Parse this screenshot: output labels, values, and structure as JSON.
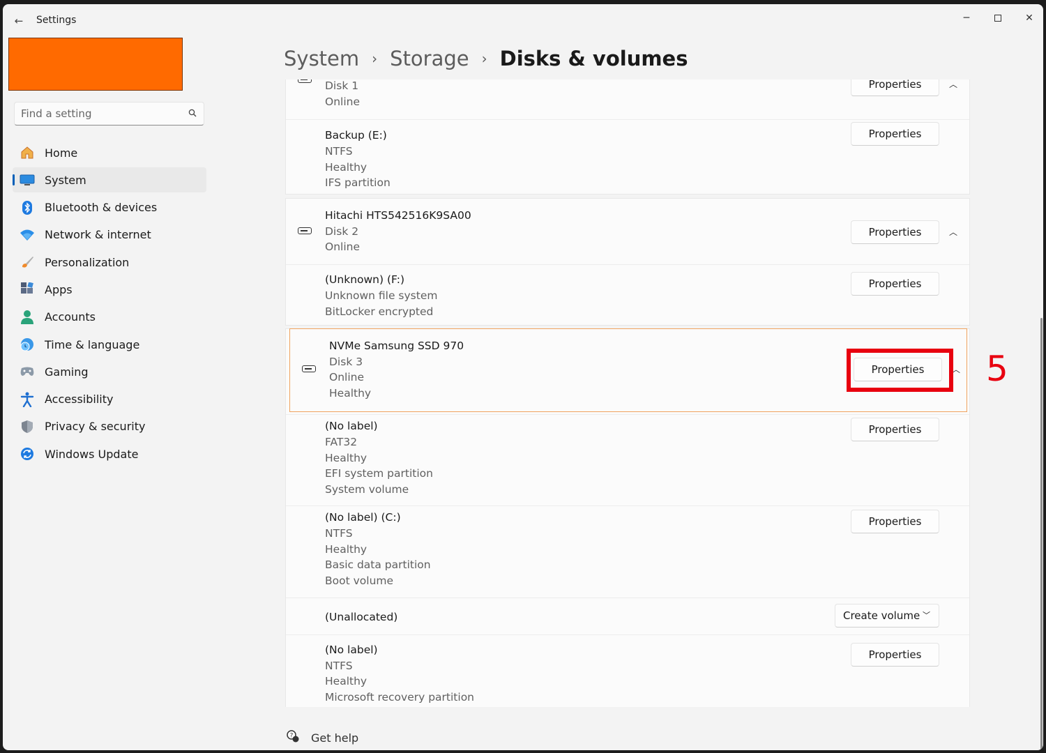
{
  "window": {
    "title": "Settings",
    "controls": {
      "minimize": "─",
      "maximize": "",
      "close": "✕"
    }
  },
  "search": {
    "placeholder": "Find a setting"
  },
  "sidebar": {
    "items": [
      {
        "label": "Home",
        "icon": "home-icon"
      },
      {
        "label": "System",
        "icon": "system-icon",
        "selected": true
      },
      {
        "label": "Bluetooth & devices",
        "icon": "bluetooth-icon"
      },
      {
        "label": "Network & internet",
        "icon": "wifi-icon"
      },
      {
        "label": "Personalization",
        "icon": "brush-icon"
      },
      {
        "label": "Apps",
        "icon": "apps-icon"
      },
      {
        "label": "Accounts",
        "icon": "accounts-icon"
      },
      {
        "label": "Time & language",
        "icon": "globe-clock-icon"
      },
      {
        "label": "Gaming",
        "icon": "gamepad-icon"
      },
      {
        "label": "Accessibility",
        "icon": "accessibility-icon"
      },
      {
        "label": "Privacy & security",
        "icon": "shield-icon"
      },
      {
        "label": "Windows Update",
        "icon": "update-icon"
      }
    ]
  },
  "breadcrumb": {
    "items": [
      "System",
      "Storage"
    ],
    "current": "Disks & volumes",
    "separator": "›"
  },
  "disks": {
    "disk1": {
      "lines": [
        "Disk 1",
        "Online"
      ],
      "button": "Properties",
      "volumes": [
        {
          "lines": [
            "Backup (E:)",
            "NTFS",
            "Healthy",
            "IFS partition"
          ],
          "button": "Properties"
        }
      ]
    },
    "disk2": {
      "lines": [
        "Hitachi HTS542516K9SA00",
        "Disk 2",
        "Online"
      ],
      "button": "Properties",
      "volumes": [
        {
          "lines": [
            "(Unknown) (F:)",
            "Unknown file system",
            "BitLocker encrypted"
          ],
          "button": "Properties"
        }
      ]
    },
    "disk3": {
      "lines": [
        "NVMe Samsung SSD 970",
        "Disk 3",
        "Online",
        "Healthy"
      ],
      "button": "Properties",
      "volumes": [
        {
          "lines": [
            "(No label)",
            "FAT32",
            "Healthy",
            "EFI system partition",
            "System volume"
          ],
          "button": "Properties"
        },
        {
          "lines": [
            "(No label) (C:)",
            "NTFS",
            "Healthy",
            "Basic data partition",
            "Boot volume"
          ],
          "button": "Properties"
        },
        {
          "lines": [
            "(Unallocated)"
          ],
          "button": "Create volume"
        },
        {
          "lines": [
            "(No label)",
            "NTFS",
            "Healthy",
            "Microsoft recovery partition"
          ],
          "button": "Properties"
        }
      ]
    }
  },
  "annotation": {
    "number": "5",
    "color": "#e8000f"
  },
  "help": {
    "label": "Get help"
  },
  "colors": {
    "accent": "#005fb8",
    "highlight_border": "#f0a35e",
    "redacted": "#ff6a00"
  }
}
